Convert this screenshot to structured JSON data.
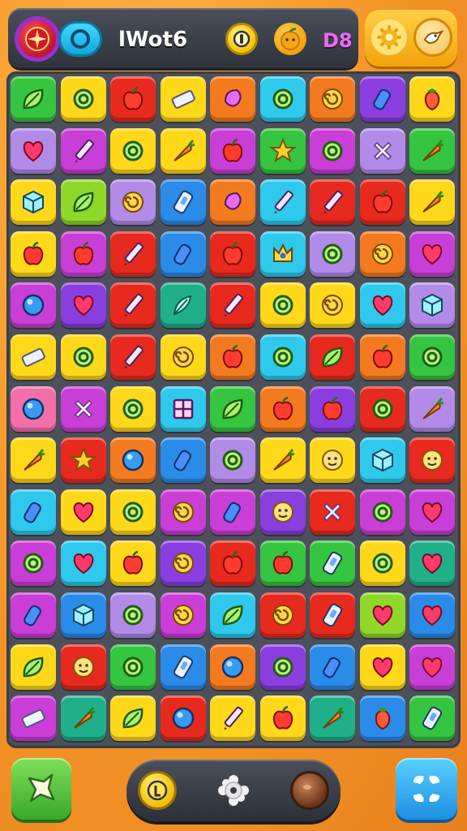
{
  "header": {
    "title": "lWot6",
    "level": "D8",
    "icons": [
      "compass-icon",
      "ring-icon",
      "coin-icon",
      "fruit-icon",
      "gear-icon",
      "bird-icon"
    ]
  },
  "colors": {
    "green": "#35c540",
    "yellow": "#ffd81a",
    "red": "#e8291e",
    "orange": "#f47a1f",
    "magenta": "#c93ed6",
    "cyan": "#2ec9ec",
    "blue": "#2a8be8",
    "purple": "#8a3ee0",
    "lime": "#8fd82a",
    "pink": "#f26fa8",
    "teal": "#1fb08a",
    "lavender": "#b28ae8"
  },
  "board": {
    "rows": [
      [
        [
          "green",
          "leaf"
        ],
        [
          "yellow",
          "ring"
        ],
        [
          "red",
          "apple"
        ],
        [
          "yellow",
          "eraser"
        ],
        [
          "orange",
          "gem"
        ],
        [
          "cyan",
          "ring"
        ],
        [
          "orange",
          "swirl"
        ],
        [
          "purple",
          "bottle"
        ],
        [
          "yellow",
          "berry"
        ]
      ],
      [
        [
          "lavender",
          "heart"
        ],
        [
          "magenta",
          "pencil"
        ],
        [
          "yellow",
          "ring"
        ],
        [
          "yellow",
          "carrot"
        ],
        [
          "magenta",
          "apple"
        ],
        [
          "green",
          "star"
        ],
        [
          "magenta",
          "ring"
        ],
        [
          "lavender",
          "cross"
        ],
        [
          "green",
          "carrot"
        ]
      ],
      [
        [
          "yellow",
          "cube"
        ],
        [
          "lime",
          "leaf"
        ],
        [
          "lavender",
          "swirl"
        ],
        [
          "blue",
          "clip"
        ],
        [
          "orange",
          "gem"
        ],
        [
          "cyan",
          "pencil"
        ],
        [
          "red",
          "pencil"
        ],
        [
          "red",
          "apple"
        ],
        [
          "yellow",
          "carrot"
        ]
      ],
      [
        [
          "yellow",
          "apple"
        ],
        [
          "magenta",
          "apple"
        ],
        [
          "red",
          "pencil"
        ],
        [
          "blue",
          "bottle"
        ],
        [
          "red",
          "apple"
        ],
        [
          "cyan",
          "crown"
        ],
        [
          "lavender",
          "ring"
        ],
        [
          "orange",
          "swirl"
        ],
        [
          "magenta",
          "heart"
        ]
      ],
      [
        [
          "magenta",
          "orb"
        ],
        [
          "purple",
          "heart"
        ],
        [
          "red",
          "pencil"
        ],
        [
          "teal",
          "feather"
        ],
        [
          "red",
          "pencil"
        ],
        [
          "yellow",
          "ring"
        ],
        [
          "yellow",
          "swirl"
        ],
        [
          "cyan",
          "heart"
        ],
        [
          "lavender",
          "cube"
        ]
      ],
      [
        [
          "yellow",
          "eraser"
        ],
        [
          "yellow",
          "ring"
        ],
        [
          "red",
          "pencil"
        ],
        [
          "yellow",
          "swirl"
        ],
        [
          "orange",
          "apple"
        ],
        [
          "cyan",
          "ring"
        ],
        [
          "red",
          "leaf"
        ],
        [
          "orange",
          "apple"
        ],
        [
          "green",
          "ring"
        ]
      ],
      [
        [
          "pink",
          "orb"
        ],
        [
          "magenta",
          "cross"
        ],
        [
          "yellow",
          "ring"
        ],
        [
          "cyan",
          "grid"
        ],
        [
          "green",
          "leaf"
        ],
        [
          "orange",
          "apple"
        ],
        [
          "purple",
          "apple"
        ],
        [
          "red",
          "ring"
        ],
        [
          "lavender",
          "carrot"
        ]
      ],
      [
        [
          "yellow",
          "carrot"
        ],
        [
          "red",
          "star"
        ],
        [
          "orange",
          "orb"
        ],
        [
          "blue",
          "bottle"
        ],
        [
          "lavender",
          "ring"
        ],
        [
          "yellow",
          "carrot"
        ],
        [
          "yellow",
          "face"
        ],
        [
          "cyan",
          "cube"
        ],
        [
          "red",
          "face"
        ]
      ],
      [
        [
          "cyan",
          "bottle"
        ],
        [
          "yellow",
          "heart"
        ],
        [
          "yellow",
          "ring"
        ],
        [
          "magenta",
          "swirl"
        ],
        [
          "magenta",
          "bottle"
        ],
        [
          "purple",
          "face"
        ],
        [
          "red",
          "cross"
        ],
        [
          "magenta",
          "ring"
        ],
        [
          "magenta",
          "heart"
        ]
      ],
      [
        [
          "magenta",
          "ring"
        ],
        [
          "cyan",
          "heart"
        ],
        [
          "yellow",
          "apple"
        ],
        [
          "purple",
          "swirl"
        ],
        [
          "red",
          "apple"
        ],
        [
          "green",
          "apple"
        ],
        [
          "green",
          "clip"
        ],
        [
          "yellow",
          "ring"
        ],
        [
          "teal",
          "heart"
        ]
      ],
      [
        [
          "magenta",
          "bottle"
        ],
        [
          "blue",
          "cube"
        ],
        [
          "lavender",
          "ring"
        ],
        [
          "magenta",
          "swirl"
        ],
        [
          "cyan",
          "leaf"
        ],
        [
          "red",
          "swirl"
        ],
        [
          "red",
          "clip"
        ],
        [
          "lime",
          "heart"
        ],
        [
          "blue",
          "heart"
        ]
      ],
      [
        [
          "yellow",
          "leaf"
        ],
        [
          "red",
          "face"
        ],
        [
          "green",
          "ring"
        ],
        [
          "blue",
          "clip"
        ],
        [
          "orange",
          "orb"
        ],
        [
          "purple",
          "ring"
        ],
        [
          "blue",
          "bottle"
        ],
        [
          "yellow",
          "heart"
        ],
        [
          "magenta",
          "heart"
        ]
      ],
      [
        [
          "magenta",
          "eraser"
        ],
        [
          "teal",
          "carrot"
        ],
        [
          "yellow",
          "leaf"
        ],
        [
          "red",
          "orb"
        ],
        [
          "yellow",
          "pencil"
        ],
        [
          "yellow",
          "apple"
        ],
        [
          "teal",
          "carrot"
        ],
        [
          "blue",
          "berry"
        ],
        [
          "green",
          "clip"
        ]
      ]
    ]
  },
  "footer": {
    "icons": [
      "shuffle-icon",
      "coin-icon",
      "gear-icon",
      "bomb-icon",
      "menu-icon"
    ]
  }
}
